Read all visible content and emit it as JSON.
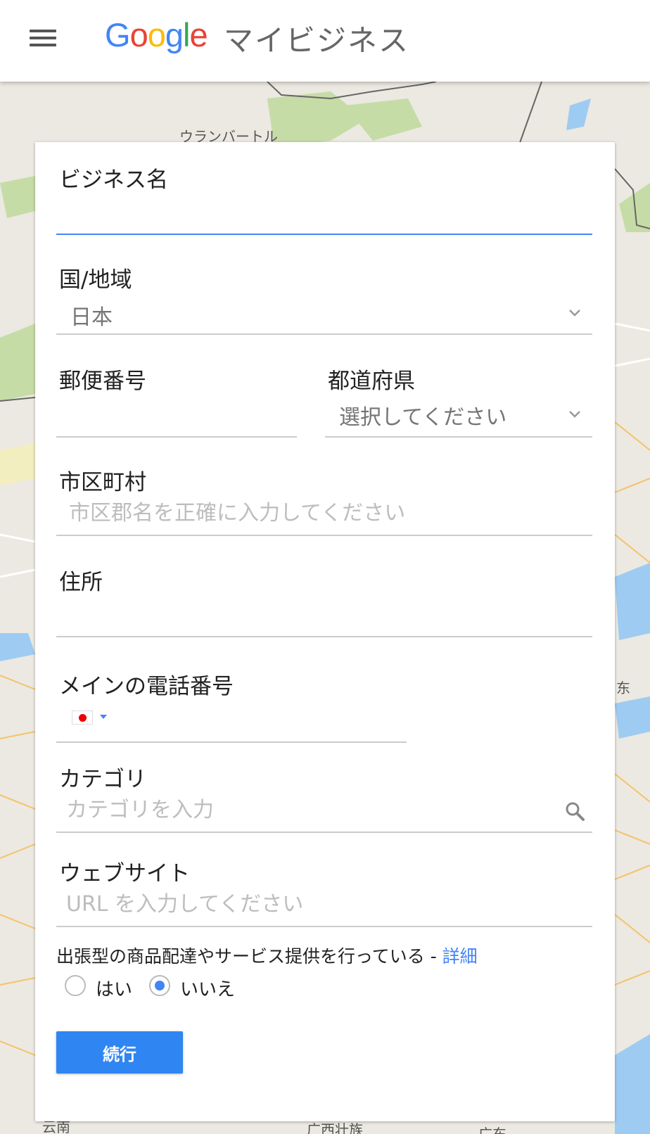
{
  "header": {
    "logo_parts": [
      "G",
      "o",
      "o",
      "g",
      "l",
      "e"
    ],
    "product_name": "マイビジネス"
  },
  "map": {
    "labels": [
      "ウランバートル",
      "东",
      "广西壮族",
      "广东",
      "云南"
    ]
  },
  "form": {
    "business_name": {
      "label": "ビジネス名",
      "value": ""
    },
    "country": {
      "label": "国/地域",
      "value": "日本"
    },
    "postal_code": {
      "label": "郵便番号",
      "value": ""
    },
    "prefecture": {
      "label": "都道府県",
      "value": "選択してください"
    },
    "city": {
      "label": "市区町村",
      "placeholder": "市区郡名を正確に入力してください"
    },
    "address": {
      "label": "住所",
      "value": ""
    },
    "phone": {
      "label": "メインの電話番号",
      "value": ""
    },
    "category": {
      "label": "カテゴリ",
      "placeholder": "カテゴリを入力"
    },
    "website": {
      "label": "ウェブサイト",
      "placeholder": "URL を入力してください"
    },
    "service_area": {
      "text": "出張型の商品配達やサービス提供を行っている - ",
      "link": "詳細",
      "options": [
        "はい",
        "いいえ"
      ],
      "selected": "いいえ"
    },
    "continue_label": "続行"
  },
  "colors": {
    "accent": "#4285f4",
    "button": "#2f85f2",
    "map_land": "#e8e6df",
    "map_green": "#c3dba0",
    "map_water": "#9ecbf2",
    "map_road": "#f8c16b"
  }
}
